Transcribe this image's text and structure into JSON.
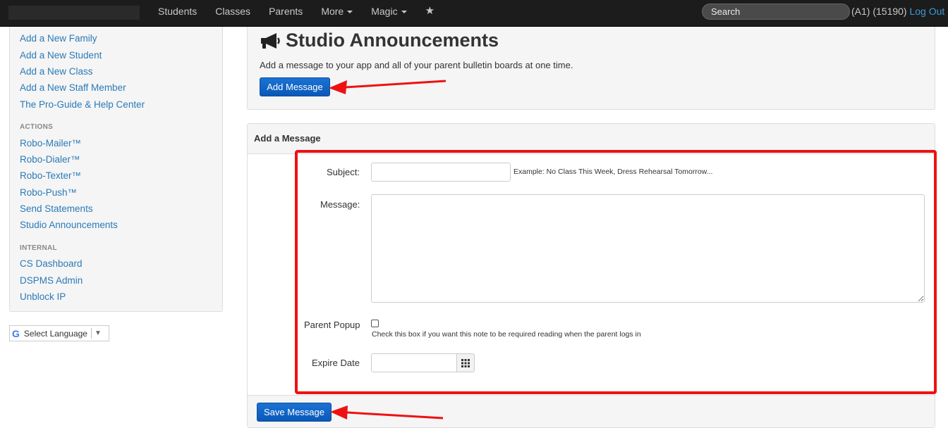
{
  "nav": {
    "items": [
      "Students",
      "Classes",
      "Parents",
      "More",
      "Magic"
    ],
    "search_placeholder": "Search",
    "account": "(A1) (15190)",
    "logout": "Log Out"
  },
  "sidebar": {
    "quick_links": [
      "Add a New Family",
      "Add a New Student",
      "Add a New Class",
      "Add a New Staff Member",
      "The Pro-Guide & Help Center"
    ],
    "actions_heading": "ACTIONS",
    "actions": [
      "Robo-Mailer™",
      "Robo-Dialer™",
      "Robo-Texter™",
      "Robo-Push™",
      "Send Statements",
      "Studio Announcements"
    ],
    "internal_heading": "INTERNAL",
    "internal": [
      "CS Dashboard",
      "DSPMS Admin",
      "Unblock IP"
    ]
  },
  "language": {
    "label": "Select Language"
  },
  "header": {
    "title": "Studio Announcements",
    "description": "Add a message to your app and all of your parent bulletin boards at one time.",
    "add_button": "Add Message"
  },
  "form": {
    "panel_title": "Add a Message",
    "subject_label": "Subject:",
    "subject_value": "",
    "subject_hint": "Example: No Class This Week, Dress Rehearsal Tomorrow...",
    "message_label": "Message:",
    "message_value": "",
    "popup_label": "Parent Popup",
    "popup_hint": "Check this box if you want this note to be required reading when the parent logs in",
    "expire_label": "Expire Date",
    "expire_value": "",
    "save_button": "Save Message"
  },
  "colors": {
    "navbar": "#1c1c1c",
    "link": "#2a7ab8",
    "primary_button": "#1a6fd0",
    "highlight": "#ee1111"
  }
}
